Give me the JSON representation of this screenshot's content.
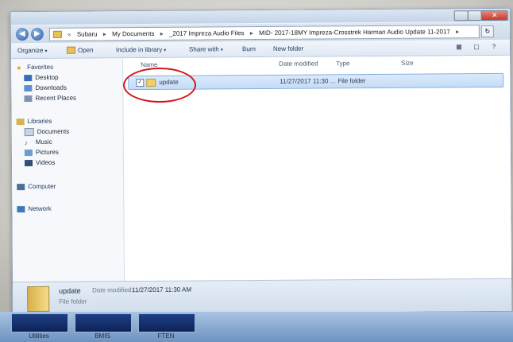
{
  "window": {
    "close_label": "✕",
    "back_icon": "back-arrow-icon",
    "forward_icon": "forward-arrow-icon"
  },
  "address": {
    "overflow": "«",
    "crumbs": [
      "Subaru",
      "My Documents",
      "_2017 Impreza Audio Files",
      "MID- 2017-18MY Impreza-Crosstrek Harman Audio Update 11-2017"
    ],
    "separator": "▸",
    "refresh_symbol": "↻"
  },
  "toolbar": {
    "organize": "Organize",
    "open": "Open",
    "include": "Include in library",
    "share": "Share with",
    "burn": "Burn",
    "new_folder": "New folder",
    "caret": "▾"
  },
  "nav": {
    "favorites": "Favorites",
    "desktop": "Desktop",
    "downloads": "Downloads",
    "recent": "Recent Places",
    "libraries": "Libraries",
    "documents": "Documents",
    "music": "Music",
    "pictures": "Pictures",
    "videos": "Videos",
    "computer": "Computer",
    "network": "Network"
  },
  "columns": {
    "name": "Name",
    "date": "Date modified",
    "type": "Type",
    "size": "Size"
  },
  "files": [
    {
      "name": "update",
      "date": "11/27/2017 11:30 ...",
      "type": "File folder",
      "size": "",
      "checked": "✓"
    }
  ],
  "details": {
    "name": "update",
    "date_label": "Date modified:",
    "date_value": "11/27/2017 11:30 AM",
    "type": "File folder"
  },
  "taskbar": {
    "items": [
      "Utilities",
      "BMIS",
      "FTEN"
    ]
  },
  "colors": {
    "annotation": "#d4171b",
    "selection": "#cce0f8"
  }
}
